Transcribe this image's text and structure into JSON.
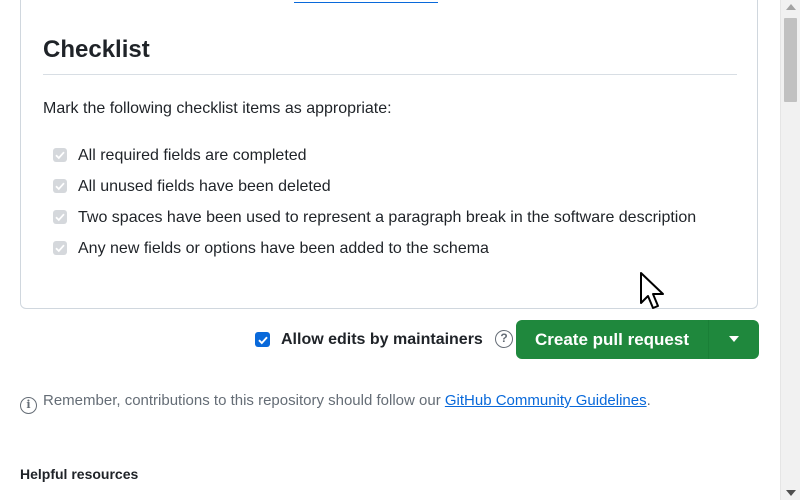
{
  "checklist": {
    "heading": "Checklist",
    "intro": "Mark the following checklist items as appropriate:",
    "items": [
      {
        "label": "All required fields are completed",
        "checked": true
      },
      {
        "label": "All unused fields have been deleted",
        "checked": true
      },
      {
        "label": "Two spaces have been used to represent a paragraph break in the software description",
        "checked": true
      },
      {
        "label": "Any new fields or options have been added to the schema",
        "checked": true
      }
    ]
  },
  "actions": {
    "allow_edits_label": "Allow edits by maintainers",
    "allow_edits_checked": true,
    "help_icon": "question-circle-icon",
    "create_button_label": "Create pull request",
    "dropdown_icon": "triangle-down-icon",
    "button_color": "#1f883d"
  },
  "footer": {
    "reminder_prefix": "Remember, contributions to this repository should follow our ",
    "guidelines_link": "GitHub Community Guidelines",
    "reminder_suffix": ".",
    "helpful_resources": "Helpful resources"
  },
  "colors": {
    "link": "#0969da",
    "text": "#1f2328",
    "muted": "#656d76",
    "checkbox_blue": "#0969da"
  }
}
